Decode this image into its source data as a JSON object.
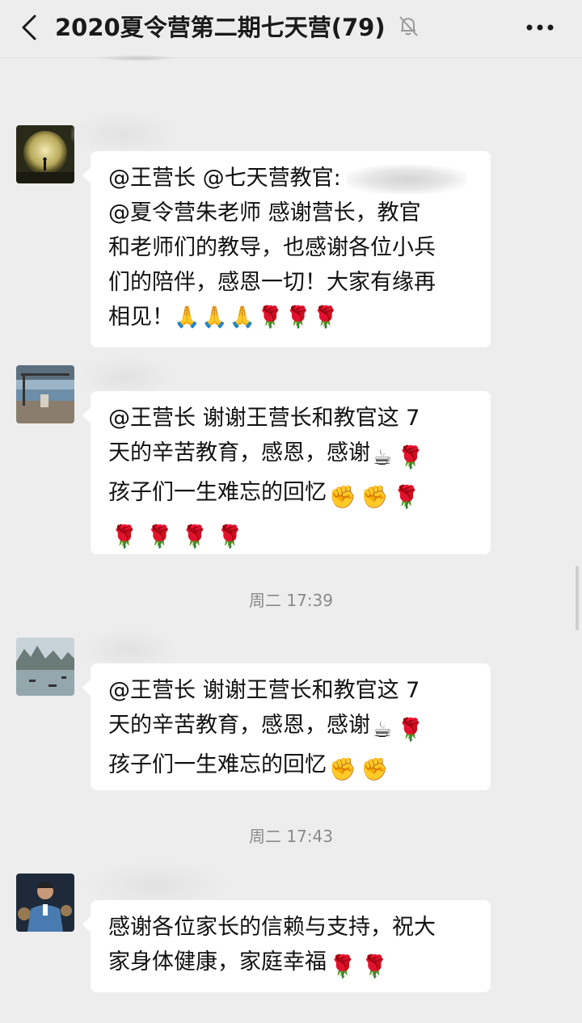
{
  "header": {
    "title": "2020夏令营第二期七天营(79)",
    "back_icon": "chevron-left-icon",
    "mute_icon": "bell-off-icon",
    "more_icon": "more-dots-icon"
  },
  "messages": [
    {
      "avatar": "moon-avatar",
      "lines": [
        "@王营长 @七天营教官:",
        "@夏令营朱老师  感谢营长，教官",
        "和老师们的教导，也感谢各位小兵",
        "们的陪伴，感恩一切！大家有缘再",
        "相见！"
      ],
      "emoji_line_end": "🙏🙏🙏🌹🌹🌹"
    },
    {
      "avatar": "seaside-avatar",
      "lines": [
        "@王营长  谢谢王营长和教官这 7",
        "天的辛苦教育，感恩，感谢",
        "孩子们一生难忘的回忆"
      ],
      "emojis": [
        "☕",
        "🌹",
        "✊",
        "✊",
        "🌹",
        "🌹🌹🌹🌹"
      ]
    },
    {
      "timestamp": "周二 17:39"
    },
    {
      "avatar": "bay-avatar",
      "lines": [
        "@王营长  谢谢王营长和教官这 7",
        "天的辛苦教育，感恩，感谢",
        "孩子们一生难忘的回忆"
      ],
      "emojis": [
        "☕",
        "🌹",
        "✊",
        "✊"
      ]
    },
    {
      "timestamp": "周二 17:43"
    },
    {
      "avatar": "person-avatar",
      "lines": [
        "感谢各位家长的信赖与支持，祝大",
        "家身体健康，家庭幸福"
      ],
      "emojis": [
        "🌹",
        "🌹"
      ]
    }
  ]
}
